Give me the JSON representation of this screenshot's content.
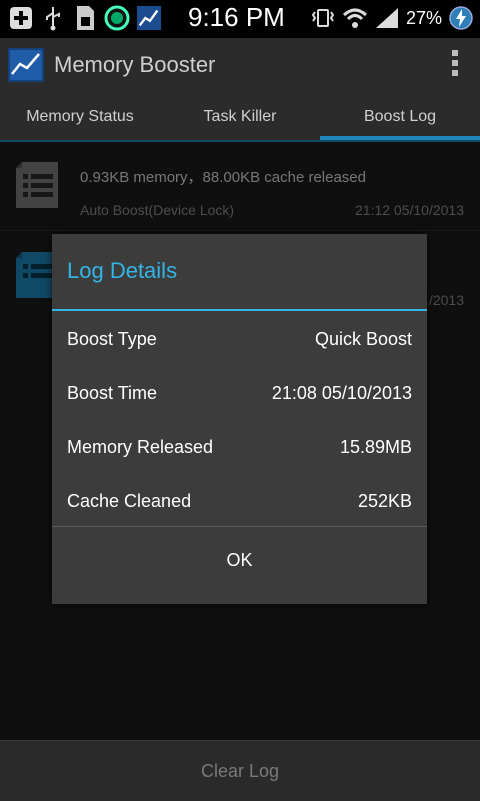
{
  "status_bar": {
    "time": "9:16 PM",
    "battery_percent": "27%",
    "icons": [
      "add-icon",
      "usb-icon",
      "sim-icon",
      "circle-app-icon",
      "chart-app-icon",
      "vibrate-icon",
      "wifi-icon",
      "signal-icon",
      "battery-charging-icon"
    ]
  },
  "action_bar": {
    "title": "Memory Booster",
    "overflow_icon": "overflow-menu-icon"
  },
  "tabs": [
    {
      "label": "Memory Status",
      "active": false
    },
    {
      "label": "Task Killer",
      "active": false
    },
    {
      "label": "Boost Log",
      "active": true
    }
  ],
  "log_items": [
    {
      "summary": "0.93KB memory，88.00KB cache released",
      "source": "Auto Boost(Device Lock)",
      "time": "21:12 05/10/2013",
      "icon": "document-list-icon"
    },
    {
      "summary": "",
      "source": "",
      "time": "/2013",
      "icon": "document-list-icon"
    }
  ],
  "dialog": {
    "title": "Log Details",
    "rows": [
      {
        "key": "Boost Type",
        "value": "Quick Boost"
      },
      {
        "key": "Boost Time",
        "value": "21:08 05/10/2013"
      },
      {
        "key": "Memory Released",
        "value": "15.89MB"
      },
      {
        "key": "Cache Cleaned",
        "value": "252KB"
      }
    ],
    "ok_label": "OK"
  },
  "bottom_button": {
    "label": "Clear Log"
  },
  "colors": {
    "accent": "#33b5e5",
    "tab_indicator": "#1e86b8",
    "background": "#1c1c1c"
  }
}
